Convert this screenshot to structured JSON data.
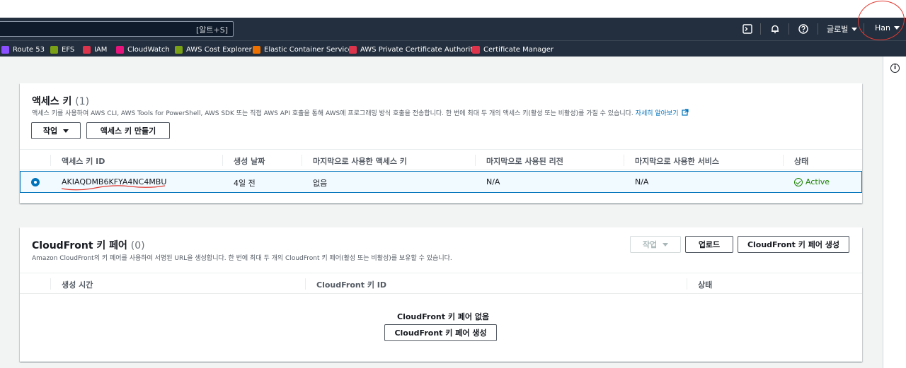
{
  "topnav": {
    "search_hint": "[알트+S]",
    "region_label": "글로벌",
    "user_label": "Han"
  },
  "favorites": [
    {
      "label": "Route 53",
      "color": "#8c4fff"
    },
    {
      "label": "EFS",
      "color": "#7aa116"
    },
    {
      "label": "IAM",
      "color": "#dd344c"
    },
    {
      "label": "CloudWatch",
      "color": "#e7157b"
    },
    {
      "label": "AWS Cost Explorer",
      "color": "#7aa116"
    },
    {
      "label": "Elastic Container Service",
      "color": "#ed7100"
    },
    {
      "label": "AWS Private Certificate Authority",
      "color": "#dd344c"
    },
    {
      "label": "Certificate Manager",
      "color": "#dd344c"
    }
  ],
  "access_keys": {
    "title": "액세스 키",
    "count": "(1)",
    "description": "액세스 키를 사용하여 AWS CLI, AWS Tools for PowerShell, AWS SDK 또는 직접 AWS API 호출을 통해 AWS에 프로그래밍 방식 호출을 전송합니다. 한 번에 최대 두 개의 액세스 키(활성 또는 비활성)를 가질 수 있습니다.",
    "learn_more": "자세히 알아보기",
    "actions_button": "작업",
    "create_button": "액세스 키 만들기",
    "columns": [
      "액세스 키 ID",
      "생성 날짜",
      "마지막으로 사용한 액세스 키",
      "마지막으로 사용된 리전",
      "마지막으로 사용한 서비스",
      "상태"
    ],
    "rows": [
      {
        "key_id": "AKIAQDMB6KFYA4NC4MBU",
        "created": "4일 전",
        "last_used": "없음",
        "last_region": "N/A",
        "last_service": "N/A",
        "status": "Active"
      }
    ]
  },
  "cloudfront": {
    "title": "CloudFront 키 페어",
    "count": "(0)",
    "description": "Amazon CloudFront의 키 페어를 사용하여 서명된 URL을 생성합니다. 한 번에 최대 두 개의 CloudFront 키 페어(활성 또는 비활성)를 보유할 수 있습니다.",
    "actions_button": "작업",
    "upload_button": "업로드",
    "create_button": "CloudFront 키 페어 생성",
    "columns": [
      "생성 시간",
      "CloudFront 키 ID",
      "상태"
    ],
    "empty_text": "CloudFront 키 페어 없음",
    "empty_create_button": "CloudFront 키 페어 생성"
  },
  "colors": {
    "nav_bg": "#232f3e",
    "link": "#0073bb",
    "active_status": "#1d8102",
    "annotation": "#e23a32"
  }
}
